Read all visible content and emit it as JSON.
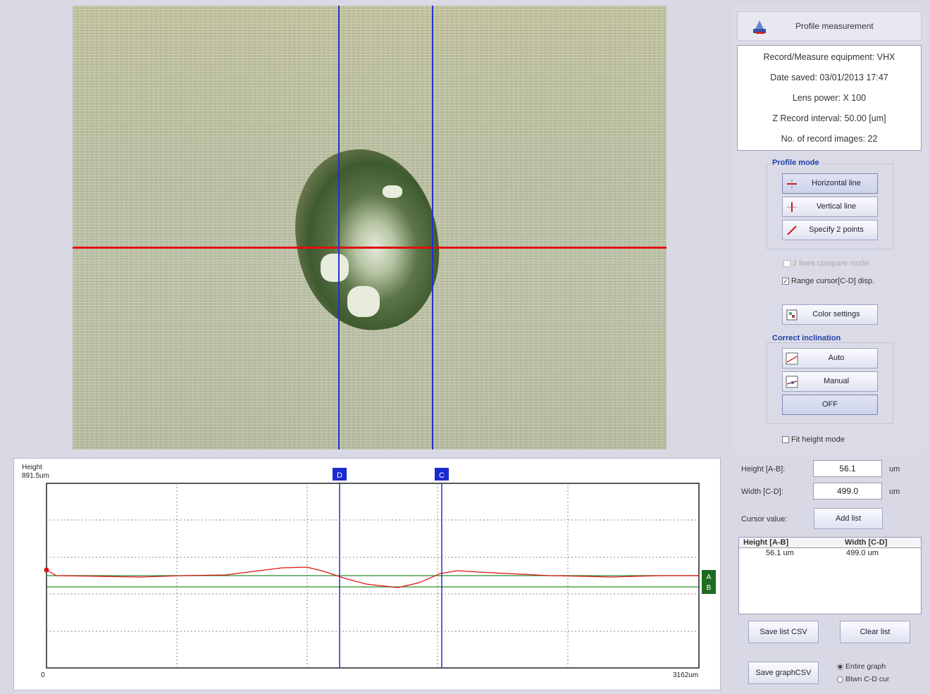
{
  "panel": {
    "title": "Profile measurement",
    "info": {
      "equipment": "Record/Measure equipment: VHX",
      "date_saved": "Date saved: 03/01/2013 17:47",
      "lens_power": "Lens power: X 100",
      "z_interval": "Z Record interval: 50.00 [um]",
      "num_images": "No. of record images: 22"
    },
    "profile_mode": {
      "label": "Profile mode",
      "horizontal": "Horizontal line",
      "vertical": "Vertical line",
      "two_points": "Specify 2 points"
    },
    "lines_compare": "2 lines compare mode",
    "range_cursor": "Range cursor[C-D] disp.",
    "color_settings": "Color settings",
    "correct_inclination": {
      "label": "Correct inclination",
      "auto": "Auto",
      "manual": "Manual",
      "off": "OFF"
    },
    "fit_height": "Fit height mode"
  },
  "graph": {
    "y_label": "Height",
    "y_max": "891.5um",
    "x_min": "0",
    "x_max": "3162um",
    "cursor_d": "D",
    "cursor_c": "C",
    "cursor_a": "A",
    "cursor_b": "B"
  },
  "measure": {
    "height_label": "Height [A-B]:",
    "height_value": "56.1",
    "height_unit": "um",
    "width_label": "Width [C-D]:",
    "width_value": "499.0",
    "width_unit": "um",
    "cursor_value_label": "Cursor value:",
    "add_list": "Add list",
    "list_headers": [
      "Height [A-B]",
      "Width [C-D]"
    ],
    "list_rows": [
      [
        "56.1 um",
        "499.0 um"
      ]
    ],
    "save_list_csv": "Save list CSV",
    "clear_list": "Clear list",
    "save_graph_csv": "Save graphCSV",
    "radio_entire": "Entire graph",
    "radio_between": "Btwn C-D cur"
  },
  "colors": {
    "profile_line": "#e01010",
    "cursor_line": "#2232c8",
    "ref_line": "#2a8a2a"
  }
}
